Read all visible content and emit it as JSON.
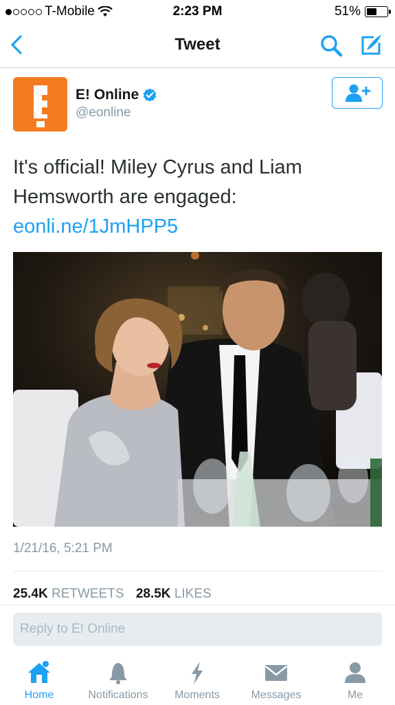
{
  "status_bar": {
    "carrier": "T-Mobile",
    "time": "2:23 PM",
    "battery": "51%",
    "battery_level": 0.51,
    "signal_bars": 1
  },
  "nav": {
    "title": "Tweet",
    "icons": [
      "chevron-left-icon",
      "search-icon",
      "compose-icon"
    ]
  },
  "tweet": {
    "author_name": "E! Online",
    "author_handle": "@eonline",
    "avatar_letter": "E",
    "verified": true,
    "text": "It's official! Miley Cyrus and Liam Hemsworth are engaged: ",
    "link": "eonli.ne/1JmHPP5",
    "timestamp": "1/21/16, 5:21 PM",
    "retweets_count": "25.4K",
    "retweets_label": "RETWEETS",
    "likes_count": "28.5K",
    "likes_label": "LIKES"
  },
  "reply": {
    "placeholder": "Reply to E! Online"
  },
  "tabs": [
    {
      "label": "Home",
      "icon": "home-icon",
      "active": true
    },
    {
      "label": "Notifications",
      "icon": "bell-icon",
      "active": false
    },
    {
      "label": "Moments",
      "icon": "lightning-icon",
      "active": false
    },
    {
      "label": "Messages",
      "icon": "envelope-icon",
      "active": false
    },
    {
      "label": "Me",
      "icon": "person-icon",
      "active": false
    }
  ],
  "colors": {
    "accent": "#1da1f2",
    "avatar_bg": "#f47b20",
    "muted": "#8899a6"
  }
}
